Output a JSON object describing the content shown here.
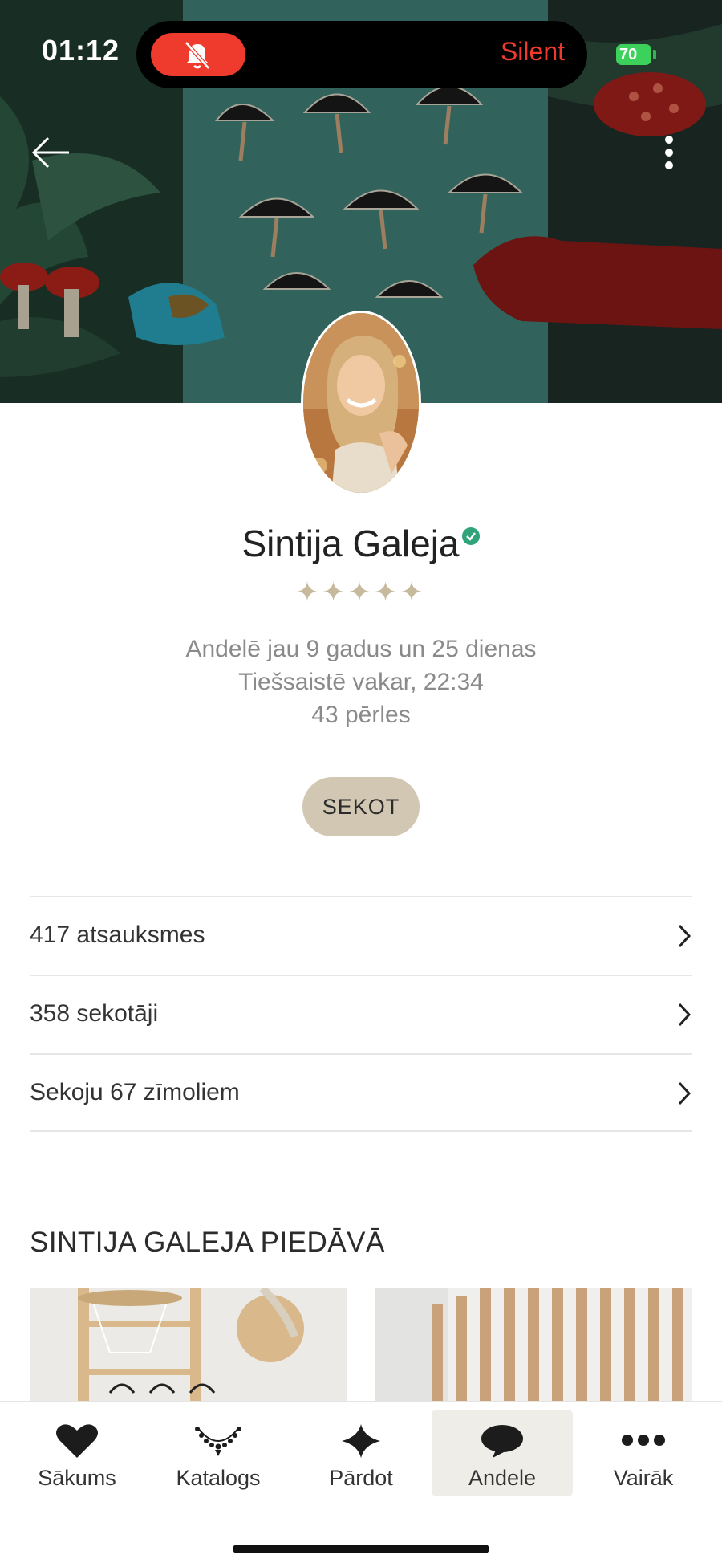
{
  "status_bar": {
    "time": "01:12",
    "silent_label": "Silent",
    "battery": "70"
  },
  "header": {
    "back_icon": "arrow-left-icon",
    "menu_icon": "more-vertical-icon"
  },
  "profile": {
    "name": "Sintija Galeja",
    "verified": true,
    "rating_icons": "✦✦✦✦✦",
    "rating": 5,
    "member_since": "Andelē jau 9 gadus un 25 dienas",
    "last_online": "Tiešsaistē vakar, 22:34",
    "pearls": "43 pērles",
    "follow_label": "SEKOT"
  },
  "links": [
    {
      "label": "417 atsauksmes"
    },
    {
      "label": "358 sekotāji"
    },
    {
      "label": "Sekoju 67 zīmoliem"
    }
  ],
  "offers": {
    "title": "SINTIJA GALEJA PIEDĀVĀ"
  },
  "nav": {
    "items": [
      {
        "label": "Sākums",
        "icon": "heart-icon"
      },
      {
        "label": "Katalogs",
        "icon": "necklace-icon"
      },
      {
        "label": "Pārdot",
        "icon": "diamond-star-icon"
      },
      {
        "label": "Andele",
        "icon": "chat-bubble-icon",
        "active": true
      },
      {
        "label": "Vairāk",
        "icon": "more-horizontal-icon"
      }
    ]
  },
  "colors": {
    "accent_beige": "#d2c7b3",
    "verified_green": "#2fa47a",
    "silent_red": "#ef3b2d",
    "battery_green": "#3bd15a"
  }
}
